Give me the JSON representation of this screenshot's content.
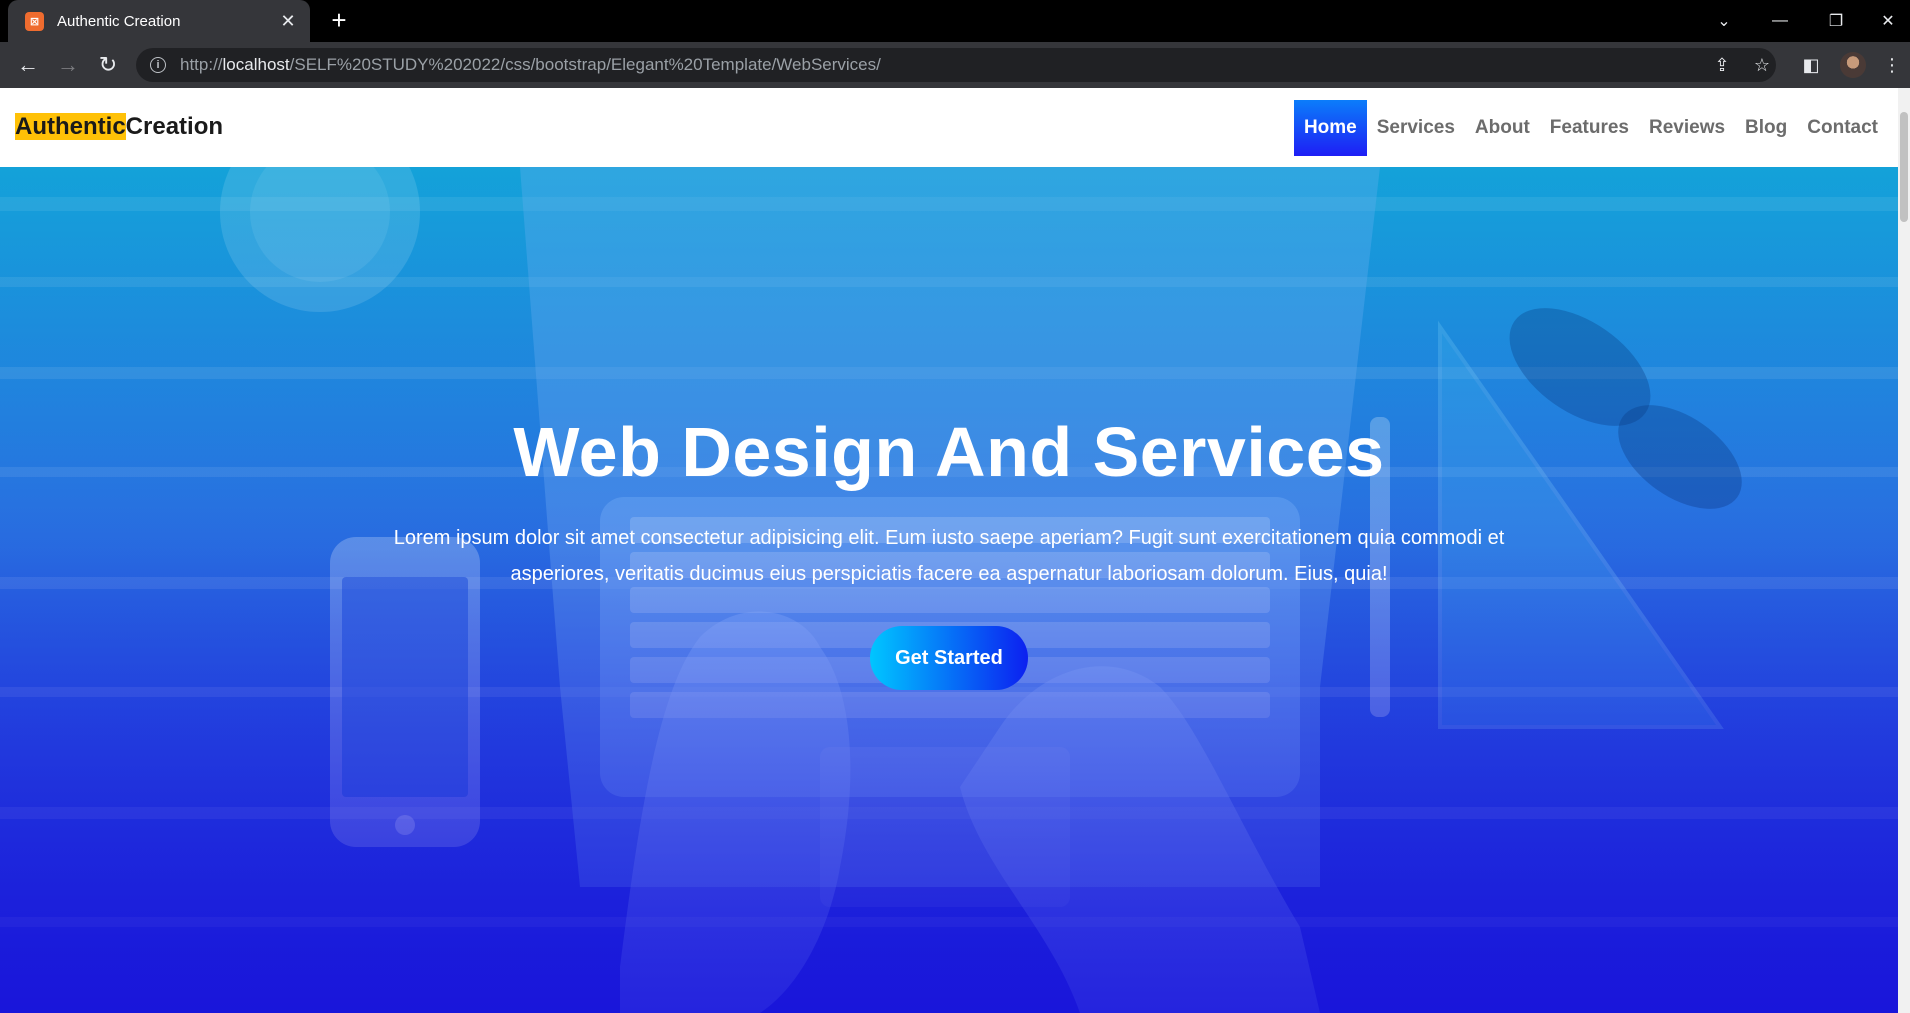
{
  "browser": {
    "tab_title": "Authentic Creation",
    "tab_icon": "xampp-icon",
    "url_prefix": "http://",
    "url_host": "localhost",
    "url_path": "/SELF%20STUDY%202022/css/bootstrap/Elegant%20Template/WebServices/"
  },
  "site": {
    "brand_highlight": "Authentic",
    "brand_rest": "Creation",
    "brand_highlight_color": "#ffc107",
    "nav": [
      {
        "label": "Home",
        "active": true
      },
      {
        "label": "Services"
      },
      {
        "label": "About"
      },
      {
        "label": "Features"
      },
      {
        "label": "Reviews"
      },
      {
        "label": "Blog"
      },
      {
        "label": "Contact"
      }
    ]
  },
  "hero": {
    "title": "Web Design And Services",
    "text": "Lorem ipsum dolor sit amet consectetur adipisicing elit. Eum iusto saepe aperiam? Fugit sunt exercitationem quia commodi et asperiores, veritatis ducimus eius perspiciatis facere ea aspernatur laboriosam dolorum. Eius, quia!",
    "cta_label": "Get Started"
  },
  "colors": {
    "accent": "#1e1ef5",
    "hero_top": "#1a9fd8",
    "hero_bottom": "#1a1ad6"
  }
}
